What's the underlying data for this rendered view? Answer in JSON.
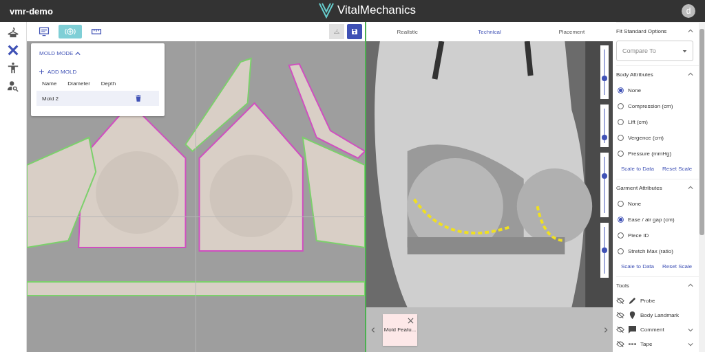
{
  "app": {
    "title": "vmr-demo",
    "logo": "**Vital**Mechanics",
    "avatar": "d"
  },
  "rail": [
    {
      "selected": false
    },
    {
      "selected": true
    },
    {
      "selected": false
    },
    {
      "selected": false
    }
  ],
  "toolbar": [
    {
      "selected": false
    },
    {
      "selected": true
    },
    {
      "selected": false
    }
  ],
  "mold_panel": {
    "title": "MOLD MODE",
    "expanded": true,
    "add": "ADD MOLD",
    "columns": [
      "Name",
      "Diameter",
      "Depth"
    ],
    "rows": [
      {
        "name": "Mold 2"
      }
    ]
  },
  "view_tabs": [
    {
      "label": "Realistic",
      "selected": false
    },
    {
      "label": "Technical",
      "selected": true
    },
    {
      "label": "Placement",
      "selected": false
    }
  ],
  "sliders": [
    {
      "level": 0.36
    },
    {
      "level": 0.17
    },
    {
      "level": 0.66
    },
    {
      "level": 0.5
    }
  ],
  "chips": [
    {
      "label": "Mold Featu..."
    }
  ],
  "sidebar": {
    "fit_title": "Fit Standard Options",
    "compare": {
      "placeholder": "Compare To"
    },
    "groups": [
      {
        "title": "Body Attributes",
        "options": [
          {
            "label": "None",
            "selected": true
          },
          {
            "label": "Compression (cm)",
            "selected": false
          },
          {
            "label": "Lift (cm)",
            "selected": false
          },
          {
            "label": "Vergence (cm)",
            "selected": false
          },
          {
            "label": "Pressure (mmHg)",
            "selected": false
          }
        ],
        "links": [
          "Scale to Data",
          "Reset Scale"
        ]
      },
      {
        "title": "Garment Attributes",
        "options": [
          {
            "label": "None",
            "selected": false
          },
          {
            "label": "Ease / air gap (cm)",
            "selected": true
          },
          {
            "label": "Piece ID",
            "selected": false
          },
          {
            "label": "Stretch Max (ratio)",
            "selected": false
          }
        ],
        "links": [
          "Scale to Data",
          "Reset Scale"
        ]
      }
    ],
    "tools_title": "Tools",
    "tools": [
      {
        "label": "Probe",
        "expandable": false
      },
      {
        "label": "Body Landmark",
        "expandable": false
      },
      {
        "label": "Comment",
        "expandable": true
      },
      {
        "label": "Tape",
        "expandable": true
      }
    ]
  }
}
